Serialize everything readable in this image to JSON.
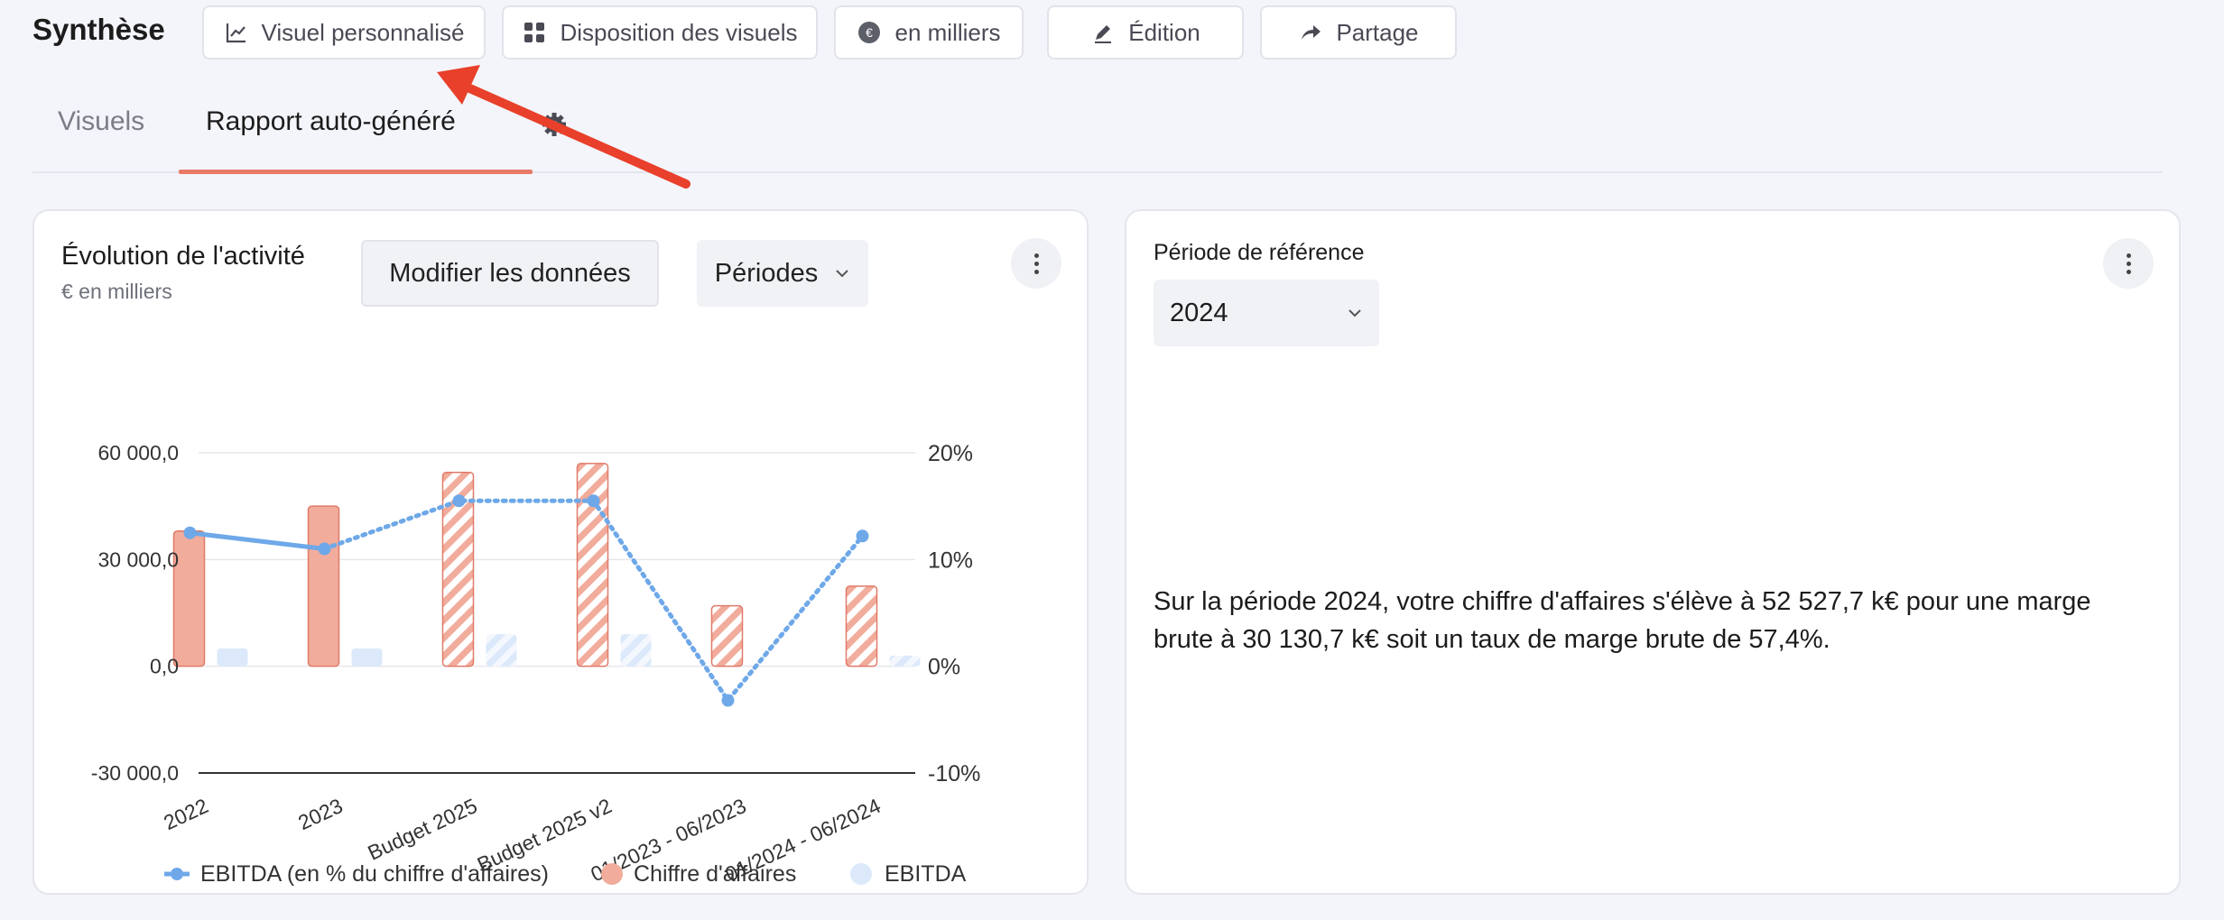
{
  "header": {
    "title": "Synthèse",
    "buttons": [
      {
        "label": "Visuel personnalisé",
        "icon": "line-chart-icon"
      },
      {
        "label": "Disposition des visuels",
        "icon": "grid-icon"
      },
      {
        "label": "en milliers",
        "icon": "euro-icon"
      },
      {
        "label": "Édition",
        "icon": "pen-icon"
      },
      {
        "label": "Partage",
        "icon": "share-icon"
      }
    ]
  },
  "tabs": [
    {
      "label": "Visuels",
      "active": false
    },
    {
      "label": "Rapport auto-généré",
      "active": true
    }
  ],
  "annotation": {
    "color": "#e8402b"
  },
  "left_card": {
    "title": "Évolution de l'activité",
    "subtitle": "€ en milliers",
    "modify_button": "Modifier les données",
    "period_button": "Périodes"
  },
  "right_card": {
    "ref_label": "Période de référence",
    "ref_value": "2024",
    "summary": "Sur la période 2024, votre chiffre d'affaires s'élève à 52 527,7 k€ pour une marge brute à 30 130,7 k€ soit un taux de marge brute de 57,4%."
  },
  "colors": {
    "bar_ca": "#f2ac9c",
    "bar_ca_stroke": "#e07a68",
    "bar_ebitda": "#dbe9fb",
    "line": "#6ea8e8",
    "accent_tab": "#e97a68"
  },
  "chart_data": {
    "type": "bar",
    "categories": [
      "2022",
      "2023",
      "Budget 2025",
      "Budget 2025 v2",
      "01/2023 - 06/2023",
      "01/2024 - 06/2024"
    ],
    "series": [
      {
        "name": "Chiffre d'affaires",
        "values": [
          38000,
          45000,
          54500,
          57000,
          17000,
          22500
        ],
        "axis": "left",
        "hatched": [
          false,
          false,
          true,
          true,
          true,
          true
        ]
      },
      {
        "name": "EBITDA",
        "values": [
          5000,
          5000,
          9000,
          9000,
          0,
          3000
        ],
        "axis": "left",
        "hatched": [
          false,
          false,
          true,
          true,
          true,
          true
        ]
      },
      {
        "name": "EBITDA (en % du chiffre d'affaires)",
        "values": [
          12.5,
          11.0,
          15.5,
          15.5,
          -3.2,
          12.2
        ],
        "axis": "right",
        "type": "line"
      }
    ],
    "y_left": {
      "ticks": [
        "60 000,0",
        "30 000,0",
        "0,0",
        "-30 000,0"
      ],
      "lim": [
        -30000,
        60000
      ]
    },
    "y_right": {
      "ticks": [
        "20%",
        "10%",
        "0%",
        "-10%"
      ],
      "lim": [
        -10,
        20
      ]
    },
    "legend": [
      "EBITDA (en % du chiffre d'affaires)",
      "Chiffre d'affaires",
      "EBITDA"
    ],
    "grid": true,
    "legend_position": "bottom"
  }
}
